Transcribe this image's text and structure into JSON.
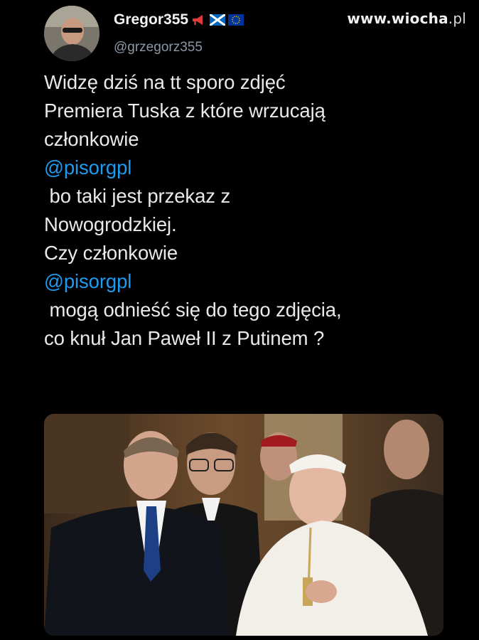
{
  "watermark": {
    "site": "www.wiocha",
    "tld": ".pl"
  },
  "author": {
    "display_name": "Gregor355",
    "handle": "@grzegorz355",
    "badges": [
      "megaphone-icon",
      "scotland-flag-icon",
      "eu-flag-icon"
    ]
  },
  "tweet": {
    "lines": [
      {
        "text": "Widzę dziś na tt sporo zdjęć"
      },
      {
        "text": "Premiera Tuska z które wrzucają"
      },
      {
        "text": "członkowie"
      },
      {
        "text": "@pisorgpl",
        "mention": true
      },
      {
        "text": " bo taki jest przekaz z"
      },
      {
        "text": "Nowogrodzkiej."
      },
      {
        "text": "Czy członkowie"
      },
      {
        "text": "@pisorgpl",
        "mention": true
      },
      {
        "text": " mogą odnieść się do tego zdjęcia,"
      },
      {
        "text": "co knuł Jan Paweł II z Putinem ?"
      }
    ]
  },
  "colors": {
    "background": "#000000",
    "text": "#e7e9ea",
    "mention": "#1d9bf0",
    "handle": "#8b98a5"
  }
}
